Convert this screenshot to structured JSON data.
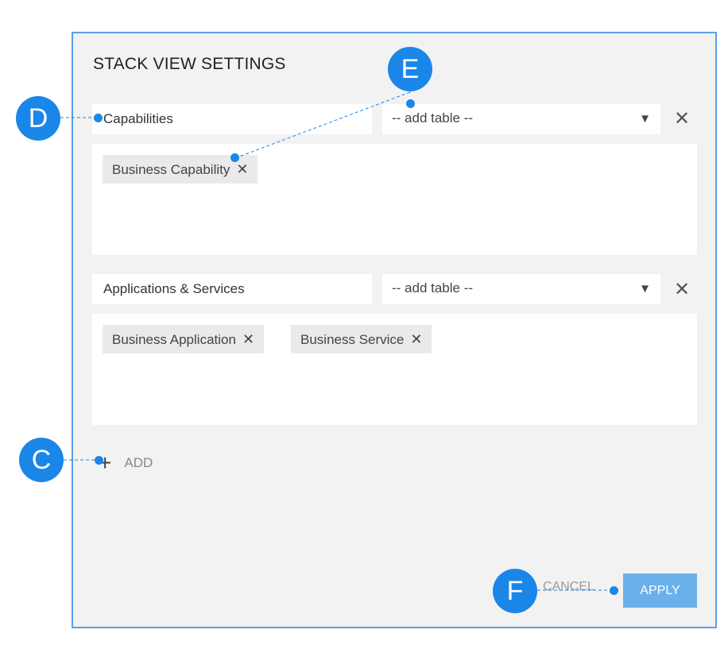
{
  "dialog": {
    "title": "STACK VIEW SETTINGS",
    "sections": [
      {
        "name_value": "Capabilities",
        "select_value": "-- add table --",
        "tags": [
          {
            "label": "Business Capability"
          }
        ]
      },
      {
        "name_value": "Applications & Services",
        "select_value": "-- add table --",
        "tags": [
          {
            "label": "Business Application"
          },
          {
            "label": "Business Service"
          }
        ]
      }
    ],
    "add_label": "ADD",
    "cancel_label": "CANCEL",
    "apply_label": "APPLY"
  },
  "callouts": {
    "c": "C",
    "d": "D",
    "e": "E",
    "f": "F"
  },
  "icons": {
    "caret": "caret-down-icon",
    "remove": "close-icon",
    "tag_remove": "close-icon",
    "add": "plus-icon"
  },
  "colors": {
    "accent": "#1a86e8",
    "apply_button": "#6ab0ea",
    "panel_border": "#5aa0e6",
    "panel_background": "#f2f2f2"
  }
}
